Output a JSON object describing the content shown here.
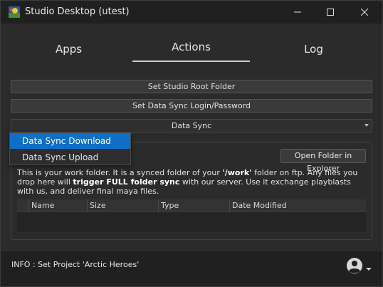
{
  "window": {
    "title": "Studio Desktop (utest)",
    "controls": [
      "minimize",
      "maximize",
      "close"
    ]
  },
  "tabs": [
    {
      "label": "Apps",
      "active": false
    },
    {
      "label": "Actions",
      "active": true
    },
    {
      "label": "Log",
      "active": false
    }
  ],
  "actions": {
    "set_root_label": "Set Studio Root Folder",
    "set_login_label": "Set Data Sync Login/Password",
    "combo_value": "Data Sync"
  },
  "dropdown": {
    "options": [
      "Data Sync Download",
      "Data Sync Upload"
    ],
    "highlighted": "Data Sync Download"
  },
  "panel": {
    "open_explorer_label": "Open Folder in Explorer",
    "desc_part1": "This is your work folder. It is a synced folder of your ",
    "desc_bold1": "'/work'",
    "desc_part2": " folder on ftp. Any files you drop here will ",
    "desc_bold2": "trigger FULL folder sync",
    "desc_part3": " with our server. Use it exchange playblasts with us, and deliver final maya files.",
    "columns": [
      "Name",
      "Size",
      "Type",
      "Date Modified"
    ]
  },
  "footer": {
    "info": "INFO :  Set Project 'Arctic Heroes'"
  },
  "colors": {
    "background": "#2b2b2b",
    "titlebar": "#202020",
    "accent_selected": "#0f6fc6"
  },
  "icons": {
    "app": "studio-app-icon",
    "user": "user-account-icon"
  }
}
